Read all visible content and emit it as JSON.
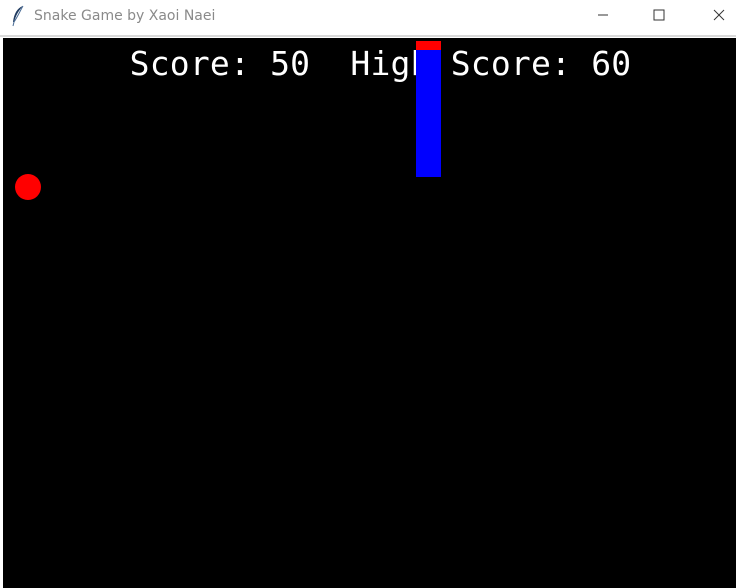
{
  "window": {
    "title": "Snake Game by Xaoi Naei",
    "icon": "feather-icon",
    "controls": [
      "minimize-icon",
      "maximize-icon",
      "close-icon"
    ]
  },
  "game": {
    "score_line": "Score: 50  High Score: 60",
    "score": 50,
    "high_score": 60,
    "colors": {
      "background": "#000000",
      "text": "#ffffff",
      "snake_body": "#0000ff",
      "snake_head": "#ff0000",
      "food": "#ff0000"
    }
  }
}
